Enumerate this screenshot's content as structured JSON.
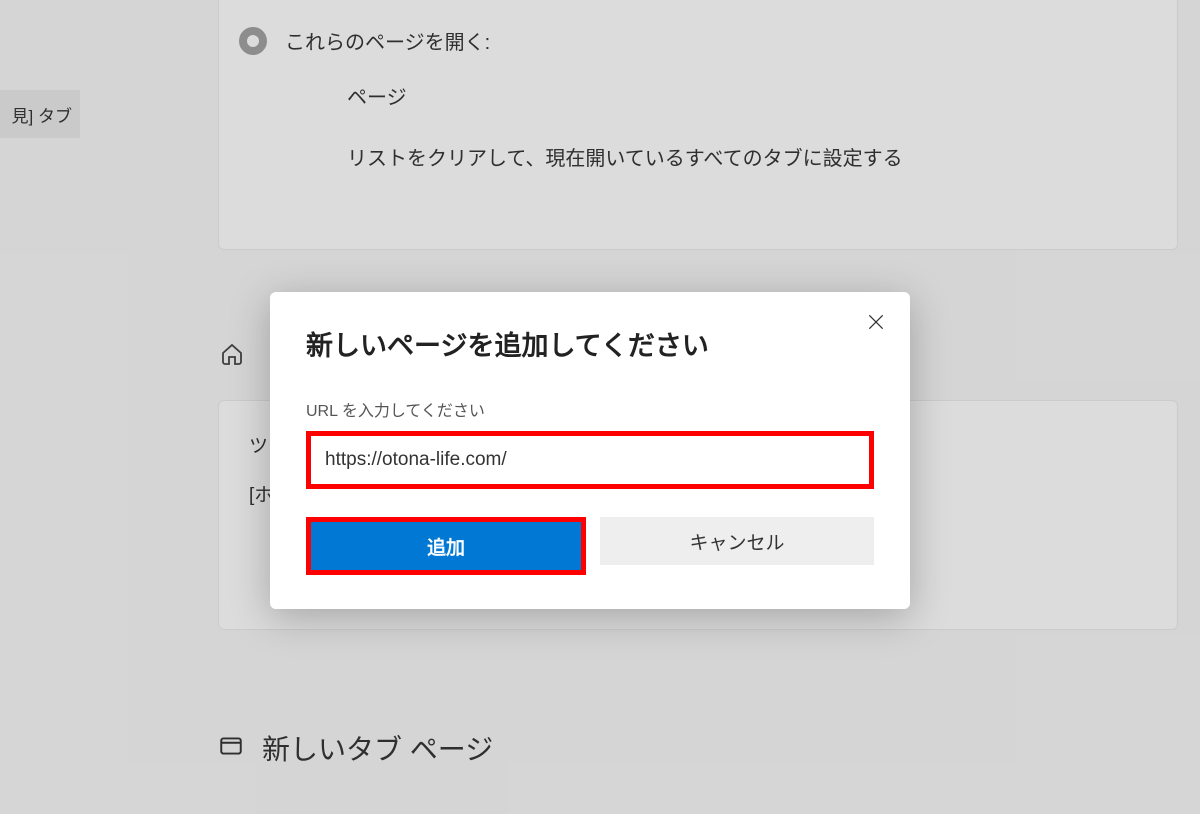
{
  "sidebar": {
    "partial_label": "見] タブ"
  },
  "settings": {
    "radio_label": "これらのページを開く:",
    "sub_page": "ページ",
    "sub_clear": "リストをクリアして、現在開いているすべてのタブに設定する"
  },
  "second": {
    "line1": "ツ",
    "line2": "[ホ"
  },
  "newtab": {
    "label": "新しいタブ ページ"
  },
  "dialog": {
    "title": "新しいページを追加してください",
    "url_label": "URL を入力してください",
    "url_value": "https://otona-life.com/",
    "add_label": "追加",
    "cancel_label": "キャンセル"
  },
  "highlight_color": "#ff0000",
  "primary_color": "#0078d4"
}
